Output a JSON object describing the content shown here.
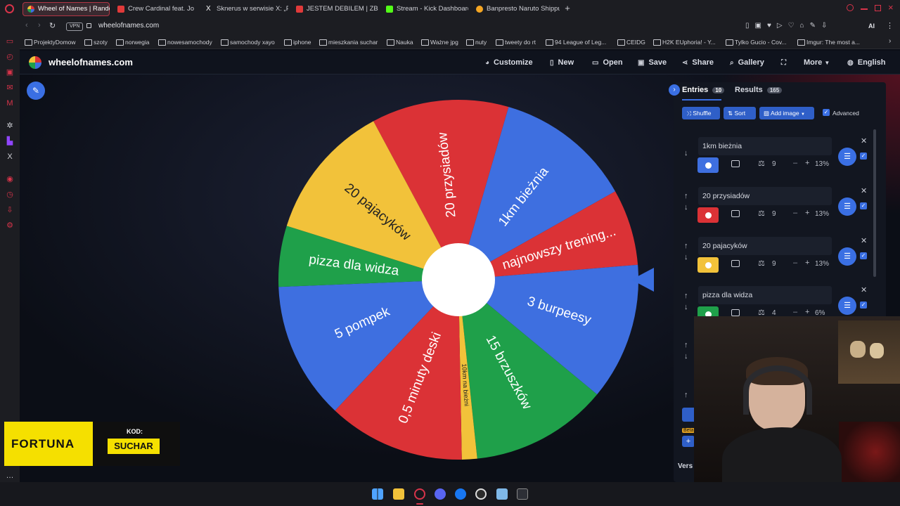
{
  "browser": {
    "tabs": [
      {
        "label": "Wheel of Names | Random",
        "active": true,
        "color": "#d8344a"
      },
      {
        "label": "Crew Cardinal feat. Jo",
        "active": false,
        "color": "#e03a3a"
      },
      {
        "label": "Sknerus w serwisie X: „P",
        "active": false,
        "color": "#ffffff"
      },
      {
        "label": "JESTEM DEBILEM | ZBUD",
        "active": false,
        "color": "#e03a3a"
      },
      {
        "label": "Stream - Kick Dashboard",
        "active": false,
        "color": "#53fc18"
      },
      {
        "label": "Banpresto Naruto Shippud",
        "active": false,
        "color": "#f5a623"
      }
    ],
    "vpn_label": "VPN",
    "url": "wheelofnames.com",
    "ai_label": "AI",
    "bookmarks": [
      "ProjektyDomow",
      "szoty",
      "norwegia",
      "nowesamochody",
      "samochody xayo",
      "iphone",
      "mieszkania suchar",
      "Nauka",
      "Ważne jpg",
      "nuty",
      "tweety do rt",
      "94 League of Leg...",
      "CEIDG",
      "H2K EUphoria! - Y...",
      "Tylko Gucio - Cov...",
      "Imgur: The most a..."
    ]
  },
  "site": {
    "logo_text": "wheelofnames.com",
    "nav": {
      "customize": "Customize",
      "new": "New",
      "open": "Open",
      "save": "Save",
      "share": "Share",
      "gallery": "Gallery",
      "more": "More",
      "language": "English"
    }
  },
  "wheel": {
    "segments": [
      {
        "label": "20 przysiadów",
        "color": "#db3236",
        "weight": 9
      },
      {
        "label": "1km bieżnia",
        "color": "#3e6fe0",
        "weight": 9
      },
      {
        "label": "najnowszy trening...",
        "color": "#db3236",
        "weight": 5
      },
      {
        "label": "3 burpeesy",
        "color": "#3e6fe0",
        "weight": 9
      },
      {
        "label": "15 brzuszków",
        "color": "#1fa04a",
        "weight": 9
      },
      {
        "label": "10km na bieżni",
        "color": "#f2c23a",
        "weight": 1
      },
      {
        "label": "0,5 minuty deski",
        "color": "#db3236",
        "weight": 9
      },
      {
        "label": "5 pompek",
        "color": "#3e6fe0",
        "weight": 9
      },
      {
        "label": "pizza dla widza",
        "color": "#1fa04a",
        "weight": 4
      },
      {
        "label": "20 pajacyków",
        "color": "#f2c23a",
        "weight": 9
      }
    ]
  },
  "panel": {
    "tabs": {
      "entries": "Entries",
      "entries_count": "10",
      "results": "Results",
      "results_count": "165"
    },
    "toolbar": {
      "shuffle": "Shuffle",
      "sort": "Sort",
      "add_image": "Add image",
      "advanced": "Advanced"
    },
    "entries": [
      {
        "text": "1km bieżnia",
        "color": "#3e6fe0",
        "weight": "9",
        "percent": "13%"
      },
      {
        "text": "20 przysiadów",
        "color": "#db3236",
        "weight": "9",
        "percent": "13%"
      },
      {
        "text": "20 pajacyków",
        "color": "#f2c23a",
        "weight": "9",
        "percent": "13%"
      },
      {
        "text": "pizza dla widza",
        "color": "#1fa04a",
        "weight": "4",
        "percent": "6%"
      }
    ],
    "version_label": "Vers",
    "beta_label": "Beta"
  },
  "ad": {
    "brand": "FORTUNA",
    "code_label": "KOD:",
    "code": "SUCHAR"
  }
}
